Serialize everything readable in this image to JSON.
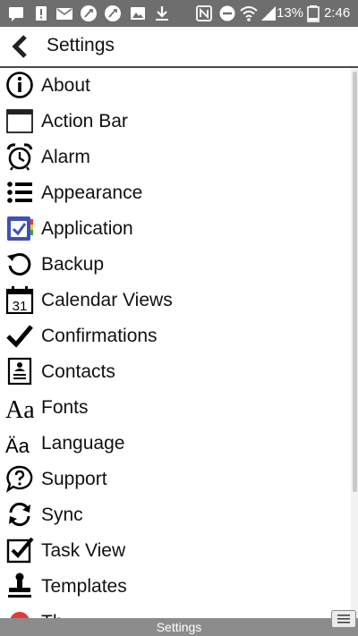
{
  "status_bar": {
    "battery": "13%",
    "time": "2:46"
  },
  "header": {
    "title": "Settings"
  },
  "items": [
    {
      "label": "About",
      "icon": "info-icon"
    },
    {
      "label": "Action Bar",
      "icon": "action-bar-icon"
    },
    {
      "label": "Alarm",
      "icon": "alarm-clock-icon"
    },
    {
      "label": "Appearance",
      "icon": "list-icon"
    },
    {
      "label": "Application",
      "icon": "app-icon"
    },
    {
      "label": "Backup",
      "icon": "backup-icon"
    },
    {
      "label": "Calendar Views",
      "icon": "calendar-icon",
      "icon_text": "31"
    },
    {
      "label": "Confirmations",
      "icon": "checkmark-icon"
    },
    {
      "label": "Contacts",
      "icon": "contact-card-icon"
    },
    {
      "label": "Fonts",
      "icon": "fonts-icon",
      "icon_text": "Aa"
    },
    {
      "label": "Language",
      "icon": "language-icon",
      "icon_text": "Äa"
    },
    {
      "label": "Support",
      "icon": "support-icon"
    },
    {
      "label": "Sync",
      "icon": "sync-icon"
    },
    {
      "label": "Task View",
      "icon": "checkbox-icon"
    },
    {
      "label": "Templates",
      "icon": "stamp-icon"
    },
    {
      "label": "Th",
      "icon": "theme-dot-icon"
    }
  ],
  "bottom_bar": {
    "title": "Settings"
  },
  "colors": {
    "status_bar": "#6e6e6e",
    "bottom_bar": "#8c8c8c",
    "app_icon_blue": "#3f51b5",
    "theme_dot": "#e53935"
  }
}
